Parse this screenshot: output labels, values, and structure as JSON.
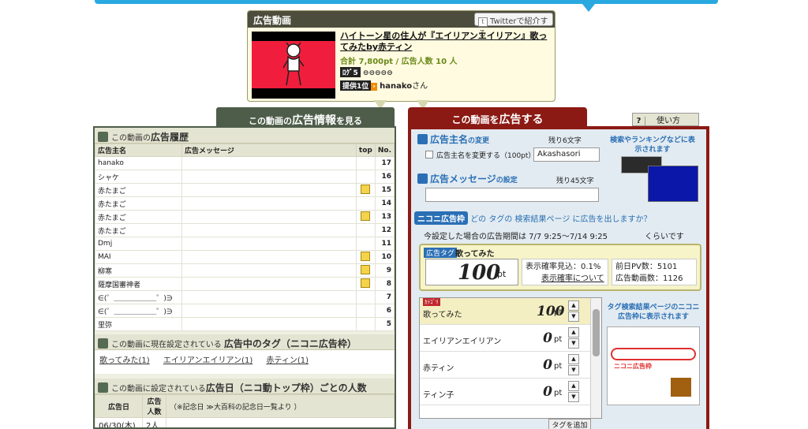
{
  "ad_video": {
    "header": "広告動画",
    "twitter_button": "Twitterで紹介する",
    "video_title": "ハイトーン星の住人が『エイリアンエイリアン』歌ってみたby赤ティン",
    "stats": "合計 7,800pt / 広告人数 10 人",
    "rank_badge": "ﾛｸﾞ5",
    "provider_badge": "提供1位",
    "provider_name": "hanako",
    "provider_suffix": "さん"
  },
  "left_panel": {
    "header_prefix": "この動画の",
    "header_bold": "広告情報",
    "header_suffix": "を見る",
    "history": {
      "title_prefix": "この動画の",
      "title_bold": "広告履歴",
      "columns": [
        "広告主名",
        "広告メッセージ",
        "top",
        "No."
      ],
      "rows": [
        {
          "name": "hanako",
          "msg": "",
          "top": false,
          "no": "17"
        },
        {
          "name": "シャケ",
          "msg": "",
          "top": false,
          "no": "16"
        },
        {
          "name": "赤たまご",
          "msg": "",
          "top": true,
          "no": "15"
        },
        {
          "name": "赤たまご",
          "msg": "",
          "top": false,
          "no": "14"
        },
        {
          "name": "赤たまご",
          "msg": "",
          "top": true,
          "no": "13"
        },
        {
          "name": "赤たまご",
          "msg": "",
          "top": false,
          "no": "12"
        },
        {
          "name": "Dmj",
          "msg": "",
          "top": false,
          "no": "11"
        },
        {
          "name": "MAI",
          "msg": "",
          "top": true,
          "no": "10"
        },
        {
          "name": "柳寒",
          "msg": "",
          "top": true,
          "no": "9"
        },
        {
          "name": "薩摩国審神者",
          "msg": "",
          "top": true,
          "no": "8"
        },
        {
          "name": "∈(゜＿＿＿＿＿＿゜)∋",
          "msg": "",
          "top": false,
          "no": "7"
        },
        {
          "name": "∈(゜＿＿＿＿＿＿゜)∋",
          "msg": "",
          "top": false,
          "no": "6"
        },
        {
          "name": "里弥",
          "msg": "",
          "top": false,
          "no": "5"
        }
      ]
    },
    "tags": {
      "title_prefix": "この動画に現在設定されている",
      "title_bold": "広告中のタグ（ニコニ広告枠）",
      "items": [
        "歌ってみた(1)",
        "エイリアンエイリアン(1)",
        "赤ティン(1)"
      ]
    },
    "dates": {
      "title_prefix": "この動画に設定されている",
      "title_bold": "広告日（ニコ動トップ枠）ごとの人数",
      "col_date": "広告日",
      "col_count": "広告人数",
      "note": "（※記念日 ≫大百科の記念日一覧より ）",
      "rows": [
        {
          "date": "06/30(木)",
          "count": "2人"
        }
      ]
    }
  },
  "right_panel": {
    "header_prefix": "この動画を",
    "header_bold": "広告する",
    "help_q": "?",
    "help_label": "使い方",
    "advertiser": {
      "title": "広告主名",
      "title_suffix": "の変更",
      "remaining": "残り6文字",
      "checkbox_label": "広告主名を変更する（100pt）",
      "value": "Akashasori"
    },
    "message": {
      "title": "広告メッセージ",
      "title_suffix": "の設定",
      "remaining": "残り45文字",
      "value": ""
    },
    "note_top": "検索やランキングなどに表示されます",
    "niconi": {
      "label": "ニコニ広告枠",
      "question": "どの タグの 検索結果ページ に広告を出しますか？",
      "period": "今設定した場合の広告期間は 7/7 9:25〜7/14 9:25",
      "period_suffix": "くらいです",
      "tag_label": "広告タグ",
      "tag_name": "歌ってみた",
      "points": "100",
      "points_unit": "pt",
      "prob_label": "表示確率見込：0.1%",
      "prob_link": "表示確率について",
      "pv_label": "前日PV数：5101",
      "ad_count_label": "広告動画数：1126"
    },
    "tag_list": [
      {
        "name": "歌ってみた",
        "pt": "100",
        "selected": true,
        "badge": "ｶﾃｺﾞﾘ"
      },
      {
        "name": "エイリアンエイリアン",
        "pt": "0",
        "selected": false
      },
      {
        "name": "赤ティン",
        "pt": "0",
        "selected": false
      },
      {
        "name": "ティン子",
        "pt": "0",
        "selected": false
      }
    ],
    "pt_unit": "pt",
    "add_tag_button": "タグを追加",
    "note_right": "タグ検索結果ページのニコニ広告枠に表示されます",
    "note_red": "ニコニ広告枠"
  }
}
